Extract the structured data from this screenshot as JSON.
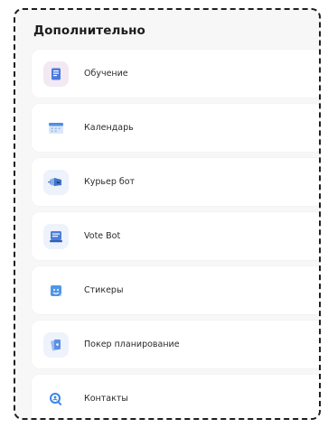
{
  "section": {
    "title": "Дополнительно"
  },
  "items": [
    {
      "label": "Обучение",
      "icon": "book-icon",
      "icon_bg": "#f2e9f3",
      "accent": "#4b7be0"
    },
    {
      "label": "Календарь",
      "icon": "calendar-icon",
      "icon_bg": "#ffffff",
      "accent": "#4f8fe6"
    },
    {
      "label": "Курьер бот",
      "icon": "courier-bot-icon",
      "icon_bg": "#edf2fb",
      "accent": "#3f73c8"
    },
    {
      "label": "Vote Bot",
      "icon": "vote-bot-icon",
      "icon_bg": "#eef2fb",
      "accent": "#4c7fe0"
    },
    {
      "label": "Стикеры",
      "icon": "sticker-icon",
      "icon_bg": "#ffffff",
      "accent": "#4f95e8"
    },
    {
      "label": "Покер планирование",
      "icon": "poker-cards-icon",
      "icon_bg": "#eef2fb",
      "accent": "#5b8fe4"
    },
    {
      "label": "Контакты",
      "icon": "contacts-search-icon",
      "icon_bg": "#ffffff",
      "accent": "#3a86e8"
    }
  ]
}
